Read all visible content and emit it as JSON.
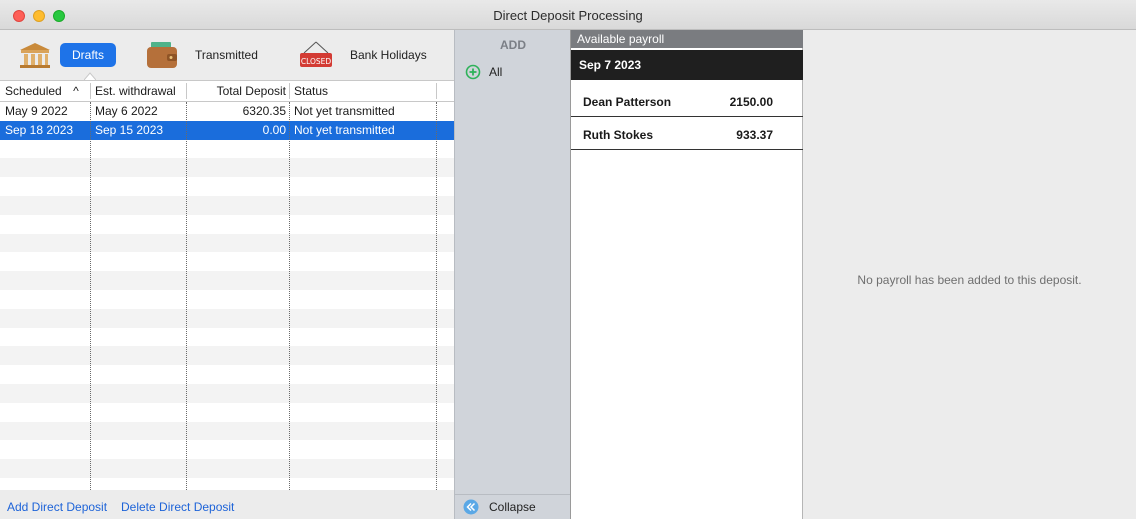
{
  "window": {
    "title": "Direct Deposit Processing"
  },
  "tabs": {
    "drafts": "Drafts",
    "transmitted": "Transmitted",
    "bank_holidays": "Bank Holidays",
    "closed_sign": "CLOSED"
  },
  "table": {
    "columns": [
      "Scheduled",
      "Est. withdrawal",
      "Total Deposit",
      "Status"
    ],
    "sort_indicator": "^",
    "rows": [
      [
        "May 9 2022",
        "May 6 2022",
        "6320.35",
        "Not yet transmitted"
      ],
      [
        "Sep 18 2023",
        "Sep 15 2023",
        "0.00",
        "Not yet transmitted"
      ]
    ]
  },
  "footer": {
    "add": "Add Direct Deposit",
    "delete": "Delete Direct Deposit"
  },
  "add_panel": {
    "title": "ADD",
    "all": "All",
    "collapse": "Collapse"
  },
  "payroll": {
    "header": "Available payroll",
    "date": "Sep 7 2023",
    "items": [
      {
        "name": "Dean Patterson",
        "amount": "2150.00"
      },
      {
        "name": "Ruth Stokes",
        "amount": "933.37"
      }
    ]
  },
  "detail": {
    "empty_message": "No payroll has been added to this deposit."
  },
  "colors": {
    "selection": "#1a6ddc",
    "link": "#1d63d8",
    "accent_green": "#2fb25a"
  }
}
